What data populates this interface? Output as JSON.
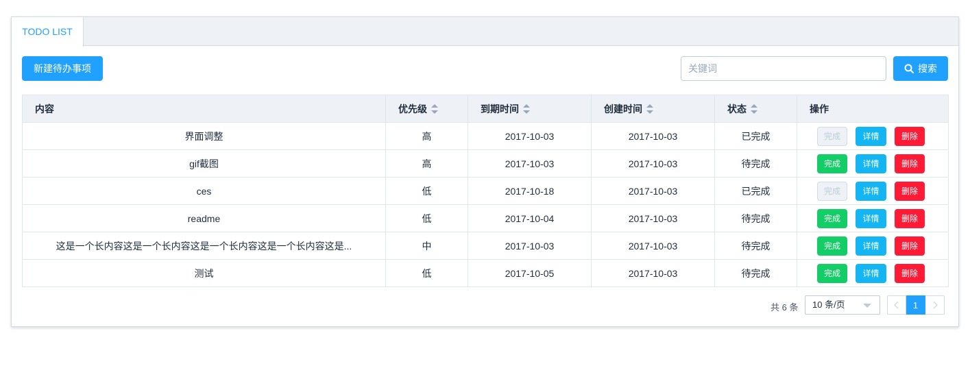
{
  "tabs": [
    {
      "label": "TODO LIST"
    }
  ],
  "toolbar": {
    "new_label": "新建待办事项",
    "search_placeholder": "关键词",
    "search_label": "搜索"
  },
  "table": {
    "headers": {
      "content": "内容",
      "priority": "优先级",
      "due": "到期时间",
      "created": "创建时间",
      "status": "状态",
      "actions": "操作"
    },
    "action_labels": {
      "done": "完成",
      "detail": "详情",
      "delete": "删除"
    },
    "rows": [
      {
        "content": "界面调整",
        "priority": "高",
        "due": "2017-10-03",
        "created": "2017-10-03",
        "status": "已完成",
        "done_disabled": true
      },
      {
        "content": "gif截图",
        "priority": "高",
        "due": "2017-10-03",
        "created": "2017-10-03",
        "status": "待完成",
        "done_disabled": false
      },
      {
        "content": "ces",
        "priority": "低",
        "due": "2017-10-18",
        "created": "2017-10-03",
        "status": "已完成",
        "done_disabled": true
      },
      {
        "content": "readme",
        "priority": "低",
        "due": "2017-10-04",
        "created": "2017-10-03",
        "status": "待完成",
        "done_disabled": false
      },
      {
        "content": "这是一个长内容这是一个长内容这是一个长内容这是一个长内容这是...",
        "priority": "中",
        "due": "2017-10-03",
        "created": "2017-10-03",
        "status": "待完成",
        "done_disabled": false
      },
      {
        "content": "测试",
        "priority": "低",
        "due": "2017-10-05",
        "created": "2017-10-03",
        "status": "待完成",
        "done_disabled": false
      }
    ]
  },
  "pagination": {
    "total_text": "共 6 条",
    "page_size": "10 条/页",
    "current_page": "1"
  },
  "colors": {
    "primary": "#20a0ff",
    "success": "#13ce66",
    "info": "#13b5f3",
    "danger": "#ff1a35"
  },
  "icons": {
    "search": "search-icon",
    "sort": "sort-caret-icon",
    "prev": "chevron-left-icon",
    "next": "chevron-right-icon",
    "dropdown": "caret-down-icon"
  }
}
